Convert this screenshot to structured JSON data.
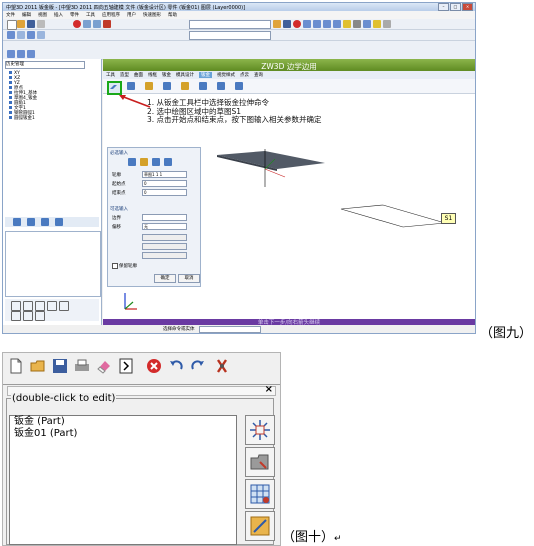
{
  "figure9": {
    "window_title": "中望3D 2011 钣金版 - [中望3D 2011 四向五轴建模    文件 (钣金设计区)  零件 (钣金01)  图层 (Layer0000)]",
    "menu": [
      "文件",
      "编辑",
      "视图",
      "插入",
      "零件",
      "工具",
      "应用程序",
      "用户",
      "快速图形",
      "帮助"
    ],
    "ribbon_tabs": [
      "工具",
      "造型",
      "曲面",
      "线框",
      "钣金",
      "模具设计",
      "钣金",
      "视觉样式",
      "点云",
      "查询"
    ],
    "banner": "ZW3D 边学边用",
    "instructions": [
      "1. 从钣金工具栏中选择钣金拉伸命令",
      "2. 选中绘图区域中的草图S1",
      "3. 点击开始点和结束点，按下图输入相关参数并确定"
    ],
    "panel": {
      "required_title": "必选输入",
      "profile_label": "轮廓",
      "profile_value": "草图1  1  1",
      "start_label": "起始点",
      "start_value": "0",
      "end_label": "结束点",
      "end_value": "0",
      "optional_title": "可选输入",
      "boundary_label": "边界",
      "offset_label": "偏移",
      "offset_value": "无",
      "keep_label": "保留轮廓",
      "ok": "确定",
      "cancel": "取消"
    },
    "tree": [
      "XY",
      "XZ",
      "YZ",
      "原点",
      "拉伸1_基体",
      "草图4_钣金",
      "圆角1",
      "文字1",
      "钢管圆弧1",
      "圆弧钣金1"
    ],
    "tree_header": "历史管理",
    "sketch_label": "S1",
    "status_hint": "单击下一步/向右箭头继续",
    "cmd_prompt": "选择命令或实体",
    "caption": "（图九）",
    "accent_green": "#19a819",
    "banner_green": "#6b9a2c",
    "status_purple": "#6a3aa2"
  },
  "figure10": {
    "edit_hint": "(double-click to edit)",
    "items": [
      "钣金  (Part)",
      "钣金01  (Part)"
    ],
    "caption": "（图十）"
  }
}
